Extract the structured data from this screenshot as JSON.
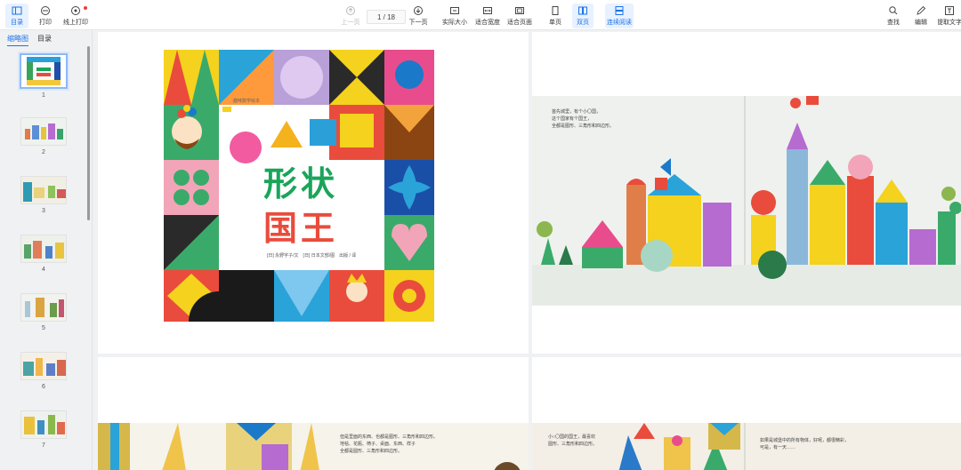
{
  "toolbar": {
    "left": [
      {
        "id": "toc",
        "label": "目录",
        "icon": "sidebar-icon",
        "active": true
      },
      {
        "id": "print",
        "label": "打印",
        "icon": "print-icon",
        "active": false
      },
      {
        "id": "online_print",
        "label": "线上打印",
        "icon": "online-print-icon",
        "active": false
      }
    ],
    "center": [
      {
        "id": "prev",
        "label": "上一页",
        "icon": "arrow-up-circle-icon",
        "disabled": true
      },
      {
        "id": "next",
        "label": "下一页",
        "icon": "arrow-down-circle-icon",
        "disabled": false
      },
      {
        "id": "actual",
        "label": "实际大小",
        "icon": "actual-size-icon",
        "disabled": false
      },
      {
        "id": "fit_width",
        "label": "适合宽度",
        "icon": "fit-width-icon",
        "disabled": false
      },
      {
        "id": "fit_page",
        "label": "适合页面",
        "icon": "fit-page-icon",
        "disabled": false
      },
      {
        "id": "single",
        "label": "单页",
        "icon": "single-page-icon",
        "disabled": false
      },
      {
        "id": "double",
        "label": "双页",
        "icon": "double-page-icon",
        "disabled": false,
        "active": true
      },
      {
        "id": "continuous",
        "label": "连续阅读",
        "icon": "continuous-read-icon",
        "disabled": false,
        "active": true
      }
    ],
    "right": [
      {
        "id": "find",
        "label": "查找",
        "icon": "search-icon"
      },
      {
        "id": "edit",
        "label": "编辑",
        "icon": "pencil-icon"
      },
      {
        "id": "extract",
        "label": "提取文字",
        "icon": "extract-text-icon"
      }
    ],
    "page_indicator": "1 / 18"
  },
  "sidebar": {
    "tabs": [
      "缩略图",
      "目录"
    ],
    "active_tab": 0,
    "thumbnails": [
      "1",
      "2",
      "3",
      "4",
      "5",
      "6",
      "7"
    ]
  },
  "book": {
    "title_line1": "形状",
    "title_line2": "国王",
    "series_label": "趣味数学绘本",
    "credits": "[日] 永野宇子/文　[日] 日本文部/图　出版 / 译",
    "page2_text": [
      "首先城里，有个小〇国，",
      "这个国家有个国王，",
      "全都是图形、三角形和四边形。"
    ],
    "page3_text": [
      "但是里面的东西、也都是图形、三角形和四边形。",
      "地毯、花瓶、椅子、桌面、东西、样子",
      "全都是圆形、三角形和四边形。"
    ],
    "page4_text_left": [
      "小○〇国的国王，最喜欢",
      "圆形、三角形和四边形。"
    ],
    "page4_text_right": [
      "如果是城堡中的所有物体，好呢，都很精彩，",
      "可是，有一天……"
    ]
  },
  "colors": {
    "accent": "#1a73e8",
    "badge": "#f23c3c"
  }
}
